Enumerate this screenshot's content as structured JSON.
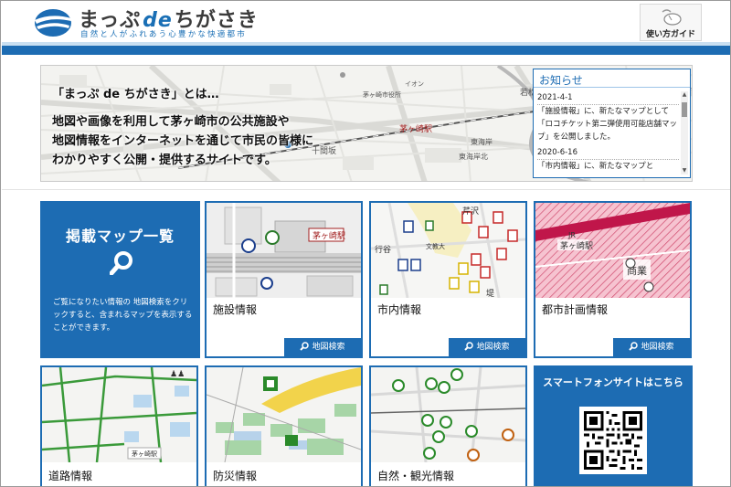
{
  "header": {
    "title_prefix": "まっぷ",
    "title_de": "de",
    "title_suffix": "ちがさき",
    "tagline": "自然と人がふれあう心豊かな快適都市",
    "guide_label": "使い方ガイド"
  },
  "hero": {
    "heading": "「まっぷ de ちがさき」とは…",
    "line1": "地図や画像を利用して茅ヶ崎市の公共施設や",
    "line2": "地図情報をインターネットを通じて市民の皆様に",
    "line3": "わかりやすく公開・提供するサイトです。",
    "map_labels": [
      "茅ヶ崎駅",
      "東海岸北",
      "十間坂",
      "若松",
      "東海岸",
      "茅ヶ崎市役所",
      "イオン"
    ]
  },
  "notice": {
    "title": "お知らせ",
    "items": [
      {
        "date": "2021-4-1",
        "text": "「施設情報」に、新たなマップとして「ロコチケット第二弾使用可能店舗マップ」を公開しました。"
      },
      {
        "date": "2020-6-16",
        "text": "「市内情報」に、新たなマップと"
      }
    ]
  },
  "map_list": {
    "title": "掲載マップ一覧",
    "description": "ご覧になりたい情報の 地図検索をクリックすると、含まれるマップを表示することができます。"
  },
  "cards": [
    {
      "label": "施設情報",
      "button": "地図検索"
    },
    {
      "label": "市内情報",
      "button": "地図検索"
    },
    {
      "label": "都市計画情報",
      "button": "地図検索"
    },
    {
      "label": "道路情報",
      "button": ""
    },
    {
      "label": "防災情報",
      "button": ""
    },
    {
      "label": "自然・観光情報",
      "button": ""
    }
  ],
  "smartphone": {
    "title_a": "スマートフォンサイト",
    "title_b": "はこちら"
  },
  "colors": {
    "brand_blue": "#1d6cb3",
    "light_blue": "#c9dff1"
  },
  "icons": [
    "logo-swoosh-icon",
    "mouse-icon",
    "search-icon",
    "qr-code"
  ]
}
